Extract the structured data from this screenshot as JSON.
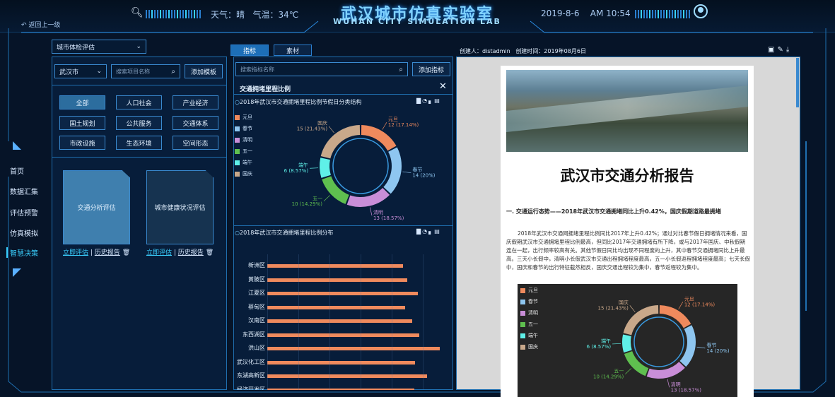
{
  "header": {
    "title": "武汉城市仿真实验室",
    "subtitle": "WUHAN CITY SIMULATION LAB",
    "weather": "天气：晴",
    "temperature": "气温：34℃",
    "date": "2019-8-6",
    "time": "AM 10:54"
  },
  "back_link": "返回上一级",
  "nav": {
    "items": [
      "首页",
      "数据汇集",
      "评估预警",
      "仿真模拟",
      "智慧决策"
    ],
    "active": "智慧决策"
  },
  "left": {
    "eval_select": "城市体检评估",
    "city_select": "武汉市",
    "search_placeholder": "搜索项目名称",
    "add_template_label": "添加模板",
    "categories": [
      "全部",
      "人口社会",
      "产业经济",
      "国土规划",
      "公共服务",
      "交通体系",
      "市政设施",
      "生态环境",
      "空间形态"
    ],
    "cards": [
      {
        "title": "交通分析评估",
        "action1": "立即评估",
        "action2": "历史报告"
      },
      {
        "title": "城市健康状况评估",
        "action1": "立即评估",
        "action2": "历史报告"
      }
    ]
  },
  "mid": {
    "tabs": [
      "指标",
      "素材"
    ],
    "search_placeholder": "搜索指标名称",
    "add_indicator_label": "添加指标",
    "panel_title": "交通拥堵里程比例",
    "chart1_title": "2018年武汉市交通拥堵里程比例节假日分类结构",
    "chart2_title": "2018年武汉市交通拥堵里程比例分布"
  },
  "report": {
    "creator": "创建人：distadmin",
    "created": "创建时间：2019年08月6日",
    "title": "武汉市交通分析报告",
    "section_heading": "一. 交通运行态势——2018年武汉市交通拥堵同比上升0.42%，国庆假期道路最拥堵",
    "paragraph": "2018年武汉市交通网拥堵里程比例同比2017年上升0.42%；通过对比春节假日拥堵情况来看，国庆假期武汉市交通拥堵里程比例最高，但同比2017年交通拥堵有所下降，或与2017年国庆、中秋假期连在一起，出行频率较高有关。其他节假日同比均出现不同程度的上升，其中春节交通拥堵同比上升最高。三天小长假中，清明小长假武汉市交通出程拥堵程度最高，五一小长假返程拥堵程度最高；七天长假中，国庆和春节的出行特征截然相反，国庆交通出程较为集中，春节返程较为集中。"
  },
  "chart_data": [
    {
      "type": "pie",
      "title": "2018年武汉市交通拥堵里程比例节假日分类结构",
      "categories": [
        "元旦",
        "春节",
        "清明",
        "五一",
        "端午",
        "国庆"
      ],
      "values": [
        12,
        14,
        13,
        10,
        6,
        15
      ],
      "labels": [
        "12 (17.14%)",
        "14 (20%)",
        "13 (18.57%)",
        "10 (14.29%)",
        "6 (8.57%)",
        "15 (21.43%)"
      ],
      "colors": [
        "#ef8a5d",
        "#8ec6f0",
        "#c98ed8",
        "#5fbf4f",
        "#5ff0e8",
        "#c9a88a"
      ],
      "legend": "left"
    },
    {
      "type": "bar",
      "orientation": "horizontal",
      "title": "2018年武汉市交通拥堵里程比例分布",
      "categories": [
        "新洲区",
        "黄陂区",
        "江夏区",
        "蔡甸区",
        "汉南区",
        "东西湖区",
        "洪山区",
        "武汉化工区",
        "东湖高新区",
        "经济开发区"
      ],
      "values": [
        0.148,
        0.152,
        0.164,
        0.15,
        0.158,
        0.165,
        0.188,
        0.161,
        0.174,
        0.16
      ],
      "color": "#ef8a5d"
    }
  ]
}
